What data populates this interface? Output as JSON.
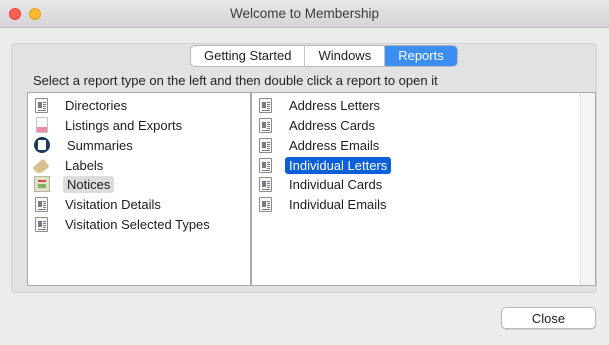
{
  "window": {
    "title": "Welcome to Membership"
  },
  "tabs": [
    {
      "label": "Getting Started",
      "active": false
    },
    {
      "label": "Windows",
      "active": false
    },
    {
      "label": "Reports",
      "active": true
    }
  ],
  "instruction": "Select a report type on the left and then double click a report to open it",
  "report_types": [
    {
      "label": "Directories",
      "icon": "document-icon"
    },
    {
      "label": "Listings and Exports",
      "icon": "listing-icon"
    },
    {
      "label": "Summaries",
      "icon": "summary-icon"
    },
    {
      "label": "Labels",
      "icon": "tag-icon"
    },
    {
      "label": "Notices",
      "icon": "notice-icon",
      "highlighted": true
    },
    {
      "label": "Visitation Details",
      "icon": "document-icon"
    },
    {
      "label": "Visitation Selected Types",
      "icon": "document-icon"
    }
  ],
  "reports": [
    {
      "label": "Address Letters",
      "icon": "document-icon"
    },
    {
      "label": "Address Cards",
      "icon": "document-icon"
    },
    {
      "label": "Address Emails",
      "icon": "document-icon"
    },
    {
      "label": "Individual Letters",
      "icon": "document-icon",
      "selected": true
    },
    {
      "label": "Individual Cards",
      "icon": "document-icon"
    },
    {
      "label": "Individual Emails",
      "icon": "document-icon"
    }
  ],
  "buttons": {
    "close": "Close"
  },
  "colors": {
    "accent": "#3c8ef3",
    "selection": "#0a60d8",
    "highlight": "#dcdcdc",
    "close_light": "#fe5f57",
    "minimize_light": "#febc2e"
  }
}
